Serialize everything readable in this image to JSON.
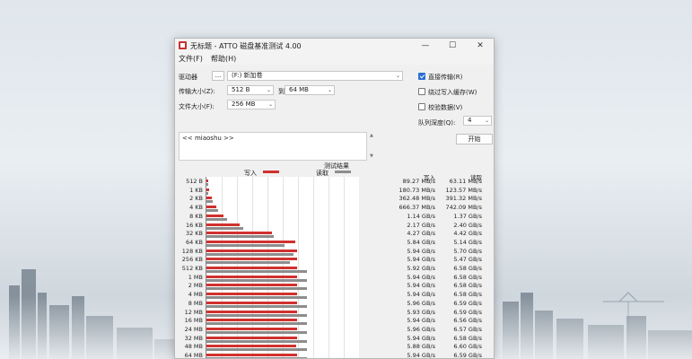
{
  "window": {
    "title": "无标题 - ATTO 磁盘基准测试 4.00",
    "minimize_icon": "minimize-icon",
    "maximize_icon": "maximize-icon",
    "close_icon": "close-icon"
  },
  "menu": {
    "file": "文件(F)",
    "help": "帮助(H)"
  },
  "form": {
    "drive_label": "驱动器",
    "drive_button": "...",
    "drive_value": "(F:) 新加卷",
    "transfer_label": "传输大小(Z):",
    "transfer_from": "512 B",
    "to_label": "到",
    "transfer_to": "64 MB",
    "file_size_label": "文件大小(F):",
    "file_size": "256 MB"
  },
  "options": {
    "direct_io": "直接传输(R)",
    "direct_io_checked": true,
    "bypass_cache": "绕过写入缓存(W)",
    "bypass_cache_checked": false,
    "verify": "校验数据(V)",
    "verify_checked": false,
    "queue_label": "队列深度(Q):",
    "queue_value": "4",
    "start_button": "开始"
  },
  "description": "<< miaoshu >>",
  "chart_data": {
    "type": "bar",
    "title": "测试结果",
    "legend": [
      {
        "name": "写入",
        "color": "#d0312d"
      },
      {
        "name": "读取",
        "color": "#8d8d8d"
      }
    ],
    "columns": {
      "write": "写入",
      "read": "读取"
    },
    "categories": [
      "512 B",
      "1 KB",
      "2 KB",
      "4 KB",
      "8 KB",
      "16 KB",
      "32 KB",
      "64 KB",
      "128 KB",
      "256 KB",
      "512 KB",
      "1 MB",
      "2 MB",
      "4 MB",
      "8 MB",
      "12 MB",
      "16 MB",
      "24 MB",
      "32 MB",
      "48 MB",
      "64 MB"
    ],
    "write_labels": [
      "89.27 MB/s",
      "180.73 MB/s",
      "362.48 MB/s",
      "666.37 MB/s",
      "1.14 GB/s",
      "2.17 GB/s",
      "4.27 GB/s",
      "5.84 GB/s",
      "5.94 GB/s",
      "5.94 GB/s",
      "5.92 GB/s",
      "5.94 GB/s",
      "5.94 GB/s",
      "5.94 GB/s",
      "5.96 GB/s",
      "5.93 GB/s",
      "5.94 GB/s",
      "5.96 GB/s",
      "5.94 GB/s",
      "5.88 GB/s",
      "5.94 GB/s"
    ],
    "read_labels": [
      "63.11 MB/s",
      "123.57 MB/s",
      "391.32 MB/s",
      "742.09 MB/s",
      "1.37 GB/s",
      "2.40 GB/s",
      "4.42 GB/s",
      "5.14 GB/s",
      "5.70 GB/s",
      "5.47 GB/s",
      "6.58 GB/s",
      "6.58 GB/s",
      "6.58 GB/s",
      "6.58 GB/s",
      "6.59 GB/s",
      "6.59 GB/s",
      "6.56 GB/s",
      "6.57 GB/s",
      "6.58 GB/s",
      "6.60 GB/s",
      "6.59 GB/s"
    ],
    "series": [
      {
        "name": "写入",
        "values": [
          0.089,
          0.181,
          0.362,
          0.666,
          1.14,
          2.17,
          4.27,
          5.84,
          5.94,
          5.94,
          5.92,
          5.94,
          5.94,
          5.94,
          5.96,
          5.93,
          5.94,
          5.96,
          5.94,
          5.88,
          5.94
        ]
      },
      {
        "name": "读取",
        "values": [
          0.063,
          0.124,
          0.391,
          0.742,
          1.37,
          2.4,
          4.42,
          5.14,
          5.7,
          5.47,
          6.58,
          6.58,
          6.58,
          6.58,
          6.59,
          6.59,
          6.56,
          6.57,
          6.58,
          6.6,
          6.59
        ]
      }
    ],
    "xlim": [
      0,
      10
    ],
    "grid": true
  }
}
